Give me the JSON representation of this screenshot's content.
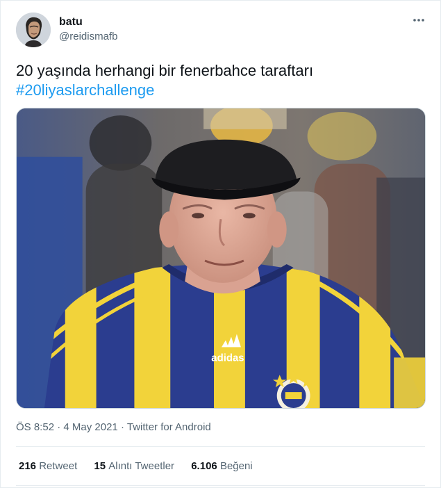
{
  "user": {
    "display_name": "batu",
    "handle": "@reidismafb"
  },
  "tweet": {
    "text": "20 yaşında herhangi bir fenerbahce taraftarı",
    "hashtag": "#20liyaslarchallenge",
    "time": "ÖS 8:52",
    "date": "4 May 2021",
    "source": "Twitter for Android",
    "separator": "·"
  },
  "stats": {
    "retweets_count": "216",
    "retweets_label": "Retweet",
    "quotes_count": "15",
    "quotes_label": "Alıntı Tweetler",
    "likes_count": "6.106",
    "likes_label": "Beğeni"
  },
  "media": {
    "jersey_logo_text": "adidas"
  },
  "colors": {
    "accent": "#1d9bf0",
    "text_primary": "#0f1419",
    "text_secondary": "#536471",
    "jersey_navy": "#2b3d8f",
    "jersey_yellow": "#f2d33a"
  }
}
